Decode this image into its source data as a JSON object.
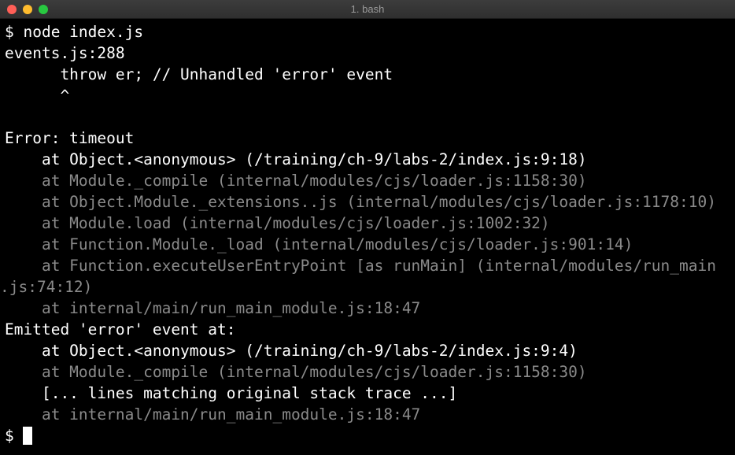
{
  "window": {
    "title": "1. bash"
  },
  "terminal": {
    "lines": [
      {
        "text": "$ node index.js",
        "style": "normal"
      },
      {
        "text": "events.js:288",
        "style": "normal"
      },
      {
        "text": "      throw er; // Unhandled 'error' event",
        "style": "normal"
      },
      {
        "text": "      ^",
        "style": "normal"
      },
      {
        "text": "",
        "style": "normal"
      },
      {
        "text": "Error: timeout",
        "style": "normal"
      },
      {
        "text": "    at Object.<anonymous> (/training/ch-9/labs-2/index.js:9:18)",
        "style": "normal"
      },
      {
        "text": "    at Module._compile (internal/modules/cjs/loader.js:1158:30)",
        "style": "dim"
      },
      {
        "text": "    at Object.Module._extensions..js (internal/modules/cjs/loader.js:1178:10)",
        "style": "dim"
      },
      {
        "text": "    at Module.load (internal/modules/cjs/loader.js:1002:32)",
        "style": "dim"
      },
      {
        "text": "    at Function.Module._load (internal/modules/cjs/loader.js:901:14)",
        "style": "dim"
      },
      {
        "text": "    at Function.executeUserEntryPoint [as runMain] (internal/modules/run_main",
        "style": "dim"
      },
      {
        "text": ".js:74:12)",
        "style": "dim"
      },
      {
        "text": "    at internal/main/run_main_module.js:18:47",
        "style": "dim"
      },
      {
        "text": "Emitted 'error' event at:",
        "style": "normal"
      },
      {
        "text": "    at Object.<anonymous> (/training/ch-9/labs-2/index.js:9:4)",
        "style": "normal"
      },
      {
        "text": "    at Module._compile (internal/modules/cjs/loader.js:1158:30)",
        "style": "dim"
      },
      {
        "text": "    [... lines matching original stack trace ...]",
        "style": "normal"
      },
      {
        "text": "    at internal/main/run_main_module.js:18:47",
        "style": "dim"
      }
    ],
    "prompt": "$ "
  }
}
